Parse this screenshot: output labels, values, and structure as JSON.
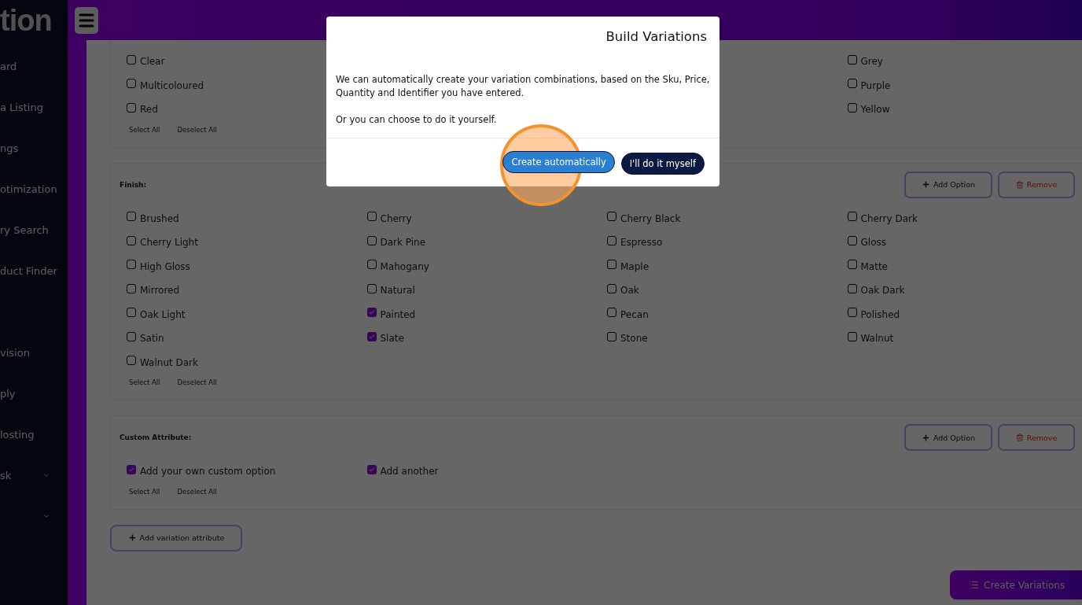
{
  "sidebar": {
    "logo": "tion",
    "items": [
      {
        "label": "ard",
        "expandable": false
      },
      {
        "label": "a Listing",
        "expandable": false
      },
      {
        "label": "ngs",
        "expandable": false
      },
      {
        "label": "otimization",
        "expandable": false
      },
      {
        "label": "ry Search",
        "expandable": false
      },
      {
        "label": "duct Finder",
        "expandable": false
      }
    ],
    "lower_items": [
      {
        "label": "vision",
        "expandable": false
      },
      {
        "label": "ply",
        "expandable": false
      },
      {
        "label": "losting",
        "expandable": false
      },
      {
        "label": "sk",
        "expandable": true
      },
      {
        "expandable": true
      }
    ]
  },
  "sections": [
    {
      "first_column": [
        {
          "label": "Clear",
          "checked": false
        },
        {
          "label": "Multicoloured",
          "checked": false
        },
        {
          "label": "Red",
          "checked": false
        }
      ],
      "last_column": [
        {
          "label": "Grey",
          "checked": false
        },
        {
          "label": "Purple",
          "checked": false
        },
        {
          "label": "Yellow",
          "checked": false
        }
      ],
      "select_all": "Select All",
      "deselect_all": "Deselect All"
    },
    {
      "title": "Finish:",
      "add_option": "Add Option",
      "remove": "Remove",
      "options": [
        {
          "label": "Brushed",
          "checked": false
        },
        {
          "label": "Cherry",
          "checked": false
        },
        {
          "label": "Cherry Black",
          "checked": false
        },
        {
          "label": "Cherry Dark",
          "checked": false
        },
        {
          "label": "Cherry Light",
          "checked": false
        },
        {
          "label": "Dark Pine",
          "checked": false
        },
        {
          "label": "Espresso",
          "checked": false
        },
        {
          "label": "Gloss",
          "checked": false
        },
        {
          "label": "High Gloss",
          "checked": false
        },
        {
          "label": "Mahogany",
          "checked": false
        },
        {
          "label": "Maple",
          "checked": false
        },
        {
          "label": "Matte",
          "checked": false
        },
        {
          "label": "Mirrored",
          "checked": false
        },
        {
          "label": "Natural",
          "checked": false
        },
        {
          "label": "Oak",
          "checked": false
        },
        {
          "label": "Oak Dark",
          "checked": false
        },
        {
          "label": "Oak Light",
          "checked": false
        },
        {
          "label": "Painted",
          "checked": true
        },
        {
          "label": "Pecan",
          "checked": false
        },
        {
          "label": "Polished",
          "checked": false
        },
        {
          "label": "Satin",
          "checked": false
        },
        {
          "label": "Slate",
          "checked": true
        },
        {
          "label": "Stone",
          "checked": false
        },
        {
          "label": "Walnut",
          "checked": false
        },
        {
          "label": "Walnut Dark",
          "checked": false
        }
      ],
      "select_all": "Select All",
      "deselect_all": "Deselect All"
    },
    {
      "title": "Custom Attribute:",
      "add_option": "Add Option",
      "remove": "Remove",
      "options": [
        {
          "label": "Add your own custom option",
          "checked": true
        },
        {
          "label": "Add another",
          "checked": true
        }
      ],
      "select_all": "Select All",
      "deselect_all": "Deselect All"
    }
  ],
  "add_variation_attribute": "Add variation attribute",
  "create_variations": "Create Variations",
  "modal": {
    "title": "Build Variations",
    "paragraphs": [
      "We can automatically create your variation combinations, based on the Sku, Price, Quantity and Identifier you have entered.",
      "Or you can choose to do it yourself."
    ],
    "buttons": [
      {
        "label": "Create automatically",
        "kind": "primary"
      },
      {
        "label": "I'll do it myself",
        "kind": "dark"
      }
    ]
  }
}
